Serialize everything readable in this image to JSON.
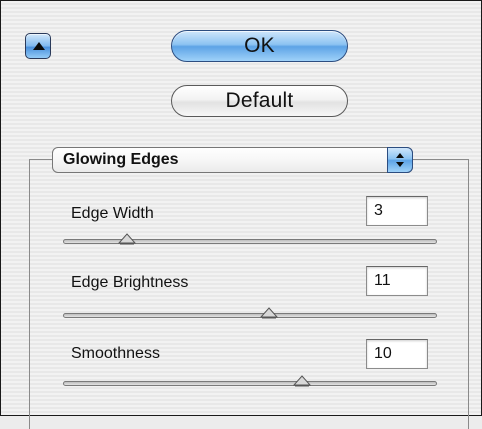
{
  "buttons": {
    "collapse_label": "",
    "ok_label": "OK",
    "default_label": "Default"
  },
  "filter_popup": {
    "selected": "Glowing Edges"
  },
  "parameters": [
    {
      "label": "Edge Width",
      "value": "3",
      "min": 1,
      "max": 14,
      "fraction": 0.17
    },
    {
      "label": "Edge Brightness",
      "value": "11",
      "min": 0,
      "max": 20,
      "fraction": 0.55
    },
    {
      "label": "Smoothness",
      "value": "10",
      "min": 1,
      "max": 15,
      "fraction": 0.64
    }
  ],
  "icons": {
    "collapse": "triangle-up-icon",
    "popup_arrows": "up-down-arrows-icon",
    "slider_thumb": "triangle-slider-thumb-icon"
  },
  "colors": {
    "accent_blue": "#7fb8ee",
    "border_dark": "#1a1a1a"
  }
}
